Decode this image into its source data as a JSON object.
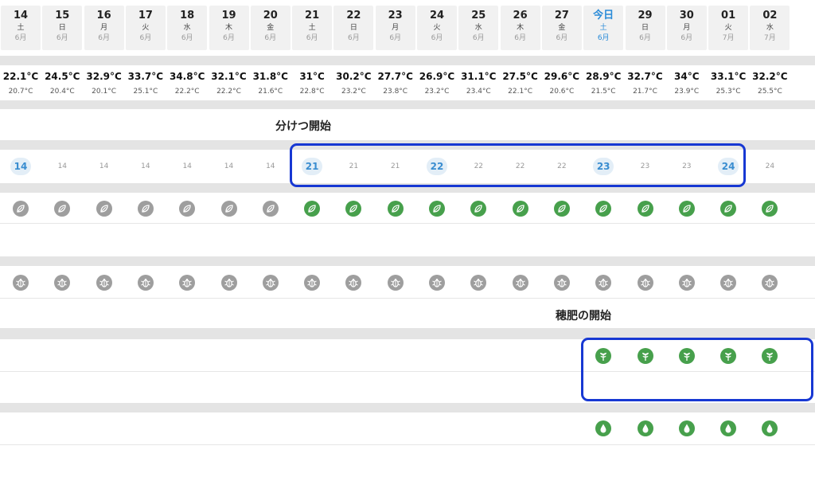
{
  "days": [
    {
      "day": "14",
      "weekday": "土",
      "month": "6月"
    },
    {
      "day": "15",
      "weekday": "日",
      "month": "6月"
    },
    {
      "day": "16",
      "weekday": "月",
      "month": "6月"
    },
    {
      "day": "17",
      "weekday": "火",
      "month": "6月"
    },
    {
      "day": "18",
      "weekday": "水",
      "month": "6月"
    },
    {
      "day": "19",
      "weekday": "木",
      "month": "6月"
    },
    {
      "day": "20",
      "weekday": "金",
      "month": "6月"
    },
    {
      "day": "21",
      "weekday": "土",
      "month": "6月"
    },
    {
      "day": "22",
      "weekday": "日",
      "month": "6月"
    },
    {
      "day": "23",
      "weekday": "月",
      "month": "6月"
    },
    {
      "day": "24",
      "weekday": "火",
      "month": "6月"
    },
    {
      "day": "25",
      "weekday": "水",
      "month": "6月"
    },
    {
      "day": "26",
      "weekday": "木",
      "month": "6月"
    },
    {
      "day": "27",
      "weekday": "金",
      "month": "6月"
    },
    {
      "day": "今日",
      "weekday": "土",
      "month": "6月",
      "today": true
    },
    {
      "day": "29",
      "weekday": "日",
      "month": "6月"
    },
    {
      "day": "30",
      "weekday": "月",
      "month": "6月"
    },
    {
      "day": "01",
      "weekday": "火",
      "month": "7月"
    },
    {
      "day": "02",
      "weekday": "水",
      "month": "7月"
    }
  ],
  "temps_max": [
    "22.1°C",
    "24.5°C",
    "32.9°C",
    "33.7°C",
    "34.8°C",
    "32.1°C",
    "31.8°C",
    "31°C",
    "30.2°C",
    "27.7°C",
    "26.9°C",
    "31.1°C",
    "27.5°C",
    "29.6°C",
    "28.9°C",
    "32.7°C",
    "34°C",
    "33.1°C",
    "32.2°C"
  ],
  "temps_min": [
    "20.7°C",
    "20.4°C",
    "20.1°C",
    "25.1°C",
    "22.2°C",
    "22.2°C",
    "21.6°C",
    "22.8°C",
    "23.2°C",
    "23.8°C",
    "23.2°C",
    "23.4°C",
    "22.1°C",
    "20.6°C",
    "21.5°C",
    "21.7°C",
    "23.9°C",
    "25.3°C",
    "25.5°C"
  ],
  "tillering_label": "分けつ開始",
  "heading_fertilizer_label": "穂肥の開始",
  "growth_weeks": [
    "14",
    "14",
    "14",
    "14",
    "14",
    "14",
    "14",
    "21",
    "21",
    "21",
    "22",
    "22",
    "22",
    "22",
    "23",
    "23",
    "23",
    "24",
    "24"
  ],
  "growth_weeks_key": [
    0,
    7,
    10,
    14,
    17
  ],
  "tillering_icons": [
    "leaf-icon-gray",
    "leaf-icon-gray",
    "leaf-icon-gray",
    "leaf-icon-gray",
    "leaf-icon-gray",
    "leaf-icon-gray",
    "leaf-icon-gray",
    "leaf-icon-green",
    "leaf-icon-green",
    "leaf-icon-green",
    "leaf-icon-green",
    "leaf-icon-green",
    "leaf-icon-green",
    "leaf-icon-green",
    "leaf-icon-green",
    "leaf-icon-green",
    "leaf-icon-green",
    "leaf-icon-green",
    "leaf-icon-green"
  ],
  "pest_icons": "bug-icon-gray",
  "fertilizer_icons_start": 14,
  "water_icons_start": 14,
  "colors": {
    "accent": "#2a8bd8",
    "green": "#47a04c",
    "gray": "#9e9e9e",
    "highlight": "#1738d3",
    "band": "#e4e4e4"
  }
}
